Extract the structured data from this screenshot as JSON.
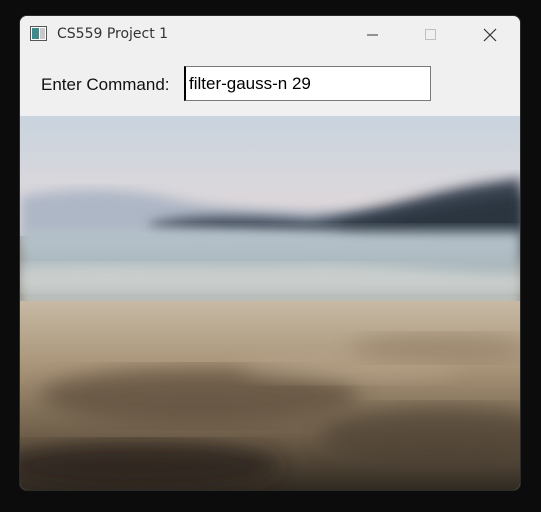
{
  "window": {
    "title": "CS559 Project 1"
  },
  "title_controls": {
    "minimize_icon": "minimize-icon",
    "maximize_icon": "maximize-icon",
    "close_icon": "close-icon"
  },
  "command": {
    "label": "Enter Command:",
    "value": "filter-gauss-n 29"
  },
  "image": {
    "description_icon": "blurred-beach-photo"
  }
}
